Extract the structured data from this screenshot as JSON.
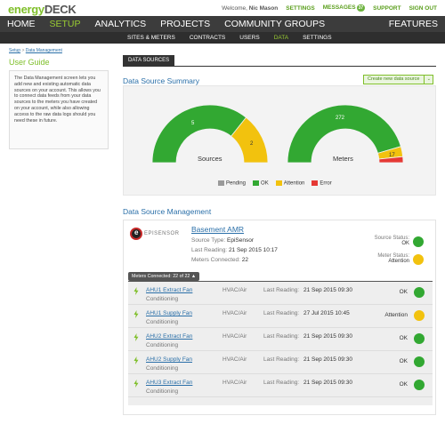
{
  "app": {
    "logo_part1": "energy",
    "logo_part2": "DECK",
    "welcome": "Welcome,",
    "user": "Nic Mason",
    "top_links": {
      "settings": "SETTINGS",
      "messages": "MESSAGES",
      "messages_count": "37",
      "support": "SUPPORT",
      "sign_out": "SIGN OUT"
    }
  },
  "main_nav": {
    "items": [
      "HOME",
      "SETUP",
      "ANALYTICS",
      "PROJECTS",
      "COMMUNITY GROUPS"
    ],
    "active": "SETUP",
    "right": "FEATURES"
  },
  "sub_nav": {
    "items": [
      "SITES & METERS",
      "CONTRACTS",
      "USERS",
      "DATA",
      "SETTINGS"
    ],
    "active": "DATA"
  },
  "breadcrumb": {
    "root": "Setup",
    "sep": ">",
    "current": "Data Management"
  },
  "user_guide": {
    "title": "User Guide",
    "text": "The Data Management screen lets you add new and existing automatic data sources on your account. This allows you to connect data feeds from your data sources to the meters you have created on your account, while also allowing access to the raw data logs should you need these in future."
  },
  "tab": "DATA SOURCES",
  "summary": {
    "title": "Data Source Summary",
    "create_button": "Create new data source",
    "create_chevron": "⌄",
    "colors": {
      "pending": "#999999",
      "ok": "#32a832",
      "attention": "#f2c20e",
      "error": "#e53935"
    },
    "gauges": [
      {
        "label": "Sources",
        "pending": 0,
        "ok": 5,
        "attention": 2,
        "error": 0,
        "ok_text": "5",
        "attention_text": "2"
      },
      {
        "label": "Meters",
        "pending": 0,
        "ok": 272,
        "attention": 17,
        "error": 10,
        "ok_text": "272",
        "attention_text": "17"
      }
    ],
    "legend": [
      "Pending",
      "OK",
      "Attention",
      "Error"
    ]
  },
  "management": {
    "title": "Data Source Management",
    "source": {
      "logo_text": "EPISENSOR",
      "name": "Basement AMR",
      "source_type_label": "Source Type:",
      "source_type": "EpiSensor",
      "last_reading_label": "Last Reading:",
      "last_reading": "21 Sep 2015 10:17",
      "meters_connected_label": "Meters Connected:",
      "meters_connected": "22",
      "source_status_label": "Source Status:",
      "source_status": "OK",
      "meter_status_label": "Meter Status:",
      "meter_status": "Attention"
    },
    "meters_pill": "Meters Connected: 22 of 22",
    "meters_pill_arrow": "▲",
    "last_reading_label": "Last Reading:",
    "meters": [
      {
        "name": "AHU1 Extract Fan",
        "type1": "HVAC/Air",
        "type2": "Conditioning",
        "last_reading": "21 Sep 2015 09:30",
        "status": "OK",
        "color": "#32a832"
      },
      {
        "name": "AHU1 Supply Fan",
        "type1": "HVAC/Air",
        "type2": "Conditioning",
        "last_reading": "27 Jul 2015 10:45",
        "status": "Attention",
        "color": "#f2c20e"
      },
      {
        "name": "AHU2 Extract Fan",
        "type1": "HVAC/Air",
        "type2": "Conditioning",
        "last_reading": "21 Sep 2015 09:30",
        "status": "OK",
        "color": "#32a832"
      },
      {
        "name": "AHU2 Supply Fan",
        "type1": "HVAC/Air",
        "type2": "Conditioning",
        "last_reading": "21 Sep 2015 09:30",
        "status": "OK",
        "color": "#32a832"
      },
      {
        "name": "AHU3 Extract Fan",
        "type1": "HVAC/Air",
        "type2": "Conditioning",
        "last_reading": "21 Sep 2015 09:30",
        "status": "OK",
        "color": "#32a832"
      }
    ]
  }
}
